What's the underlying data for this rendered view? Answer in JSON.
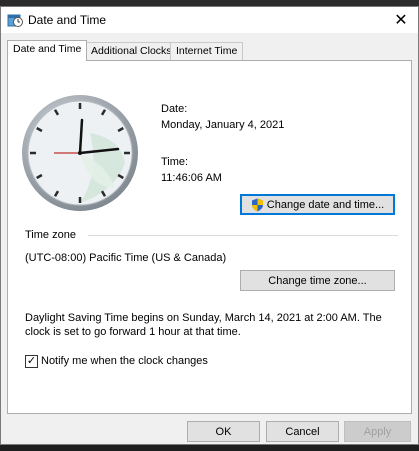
{
  "window": {
    "title": "Date and Time",
    "close_glyph": "✕"
  },
  "tabs": [
    {
      "label": "Date and Time",
      "active": true
    },
    {
      "label": "Additional Clocks",
      "active": false
    },
    {
      "label": "Internet Time",
      "active": false
    }
  ],
  "datetime": {
    "date_label": "Date:",
    "date_value": "Monday, January 4, 2021",
    "time_label": "Time:",
    "time_value": "11:46:06 AM",
    "change_button": "Change date and time..."
  },
  "timezone": {
    "group_label": "Time zone",
    "value": "(UTC-08:00) Pacific Time (US & Canada)",
    "change_button": "Change time zone..."
  },
  "dst": {
    "line1": "Daylight Saving Time begins on Sunday, March 14, 2021 at 2:00 AM. The",
    "line2": "clock is set to go forward 1 hour at that time."
  },
  "notify": {
    "label": "Notify me when the clock changes",
    "checked": true,
    "check_glyph": "✓"
  },
  "footer": {
    "ok": "OK",
    "cancel": "Cancel",
    "apply": "Apply"
  },
  "colors": {
    "accent": "#0078d7",
    "clock_face": "#eef1f4",
    "clock_rim": "#8a9199"
  },
  "icons": {
    "title": "clock-calendar-icon",
    "uac": "uac-shield-icon",
    "close": "close-icon"
  }
}
